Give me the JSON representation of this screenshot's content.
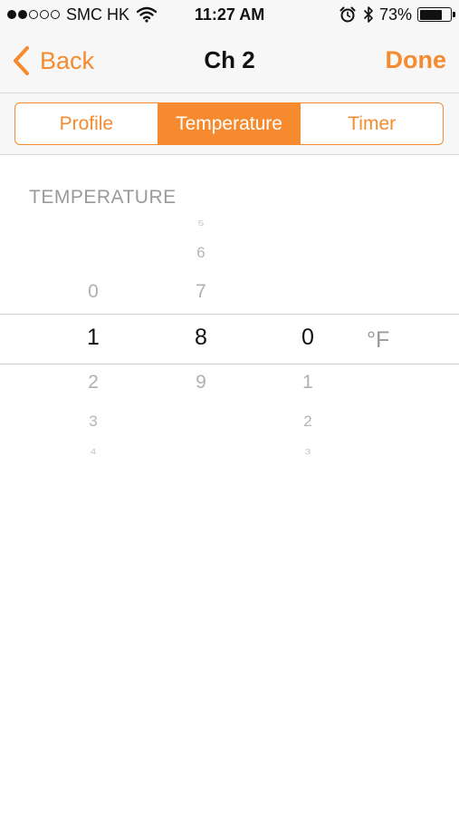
{
  "status_bar": {
    "signal_dots_filled": 2,
    "signal_dots_total": 5,
    "carrier": "SMC HK",
    "wifi_icon": "wifi-icon",
    "time": "11:27 AM",
    "alarm_icon": "alarm-clock-icon",
    "bluetooth_icon": "bluetooth-icon",
    "battery_percent": "73%",
    "battery_level": 0.73
  },
  "nav": {
    "back_label": "Back",
    "title": "Ch 2",
    "done_label": "Done"
  },
  "tabs": [
    {
      "label": "Profile",
      "active": false
    },
    {
      "label": "Temperature",
      "active": true
    },
    {
      "label": "Timer",
      "active": false
    }
  ],
  "picker": {
    "section_label": "TEMPERATURE",
    "columns": [
      {
        "above": [
          "0"
        ],
        "selected": "1",
        "below": [
          "2",
          "3",
          "4"
        ]
      },
      {
        "above": [
          "5",
          "6",
          "7"
        ],
        "selected": "8",
        "below": [
          "9"
        ]
      },
      {
        "above": [],
        "selected": "0",
        "below": [
          "1",
          "2",
          "3"
        ]
      }
    ],
    "unit": "°F"
  },
  "colors": {
    "accent": "#f58a2e",
    "bar_background": "#f7f7f7",
    "muted_text": "#9a9a9a"
  }
}
